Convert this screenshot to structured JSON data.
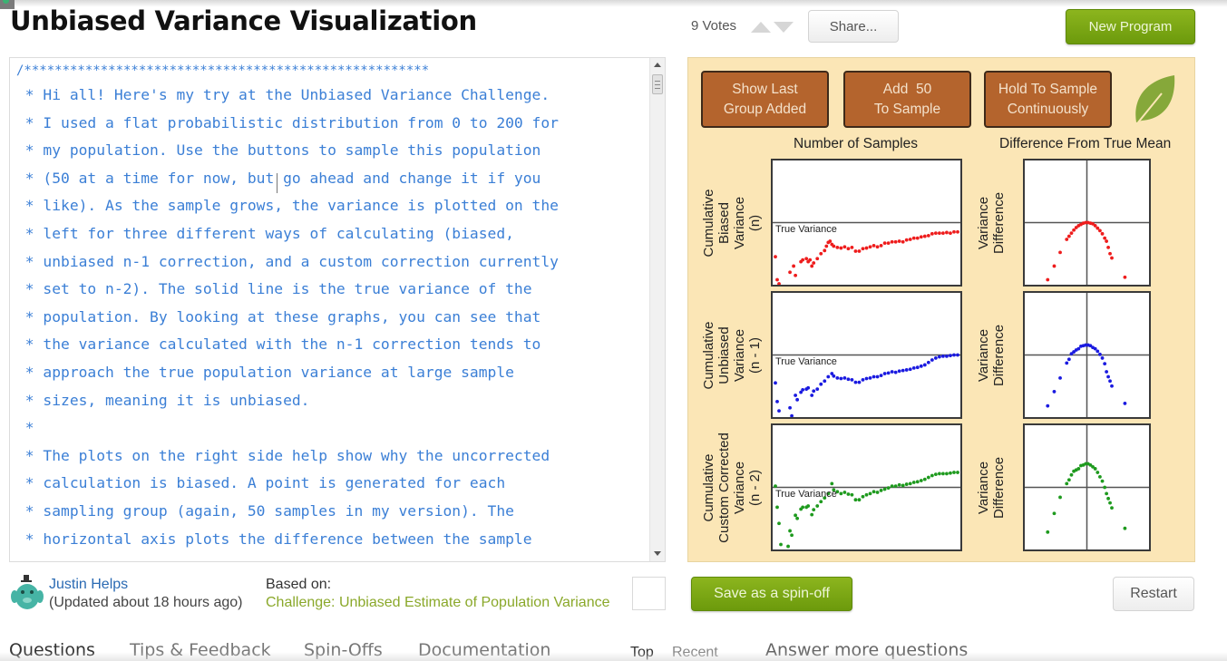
{
  "header": {
    "title": "Unbiased Variance Visualization",
    "votes_label": "9 Votes",
    "share_label": "Share...",
    "new_program_label": "New Program"
  },
  "editor": {
    "lines": [
      "/*****************************************************",
      " * Hi all! Here's my try at the Unbiased Variance Challenge.",
      " * I used a flat probabilistic distribution from 0 to 200 for",
      " * my population. Use the buttons to sample this population",
      " * (50 at a time for now, but go ahead and change it if you",
      " * like). As the sample grows, the variance is plotted on the",
      " * left for three different ways of calculating (biased,",
      " * unbiased n-1 correction, and a custom correction currently",
      " * set to n-2). The solid line is the true variance of the",
      " * population. By looking at these graphs, you can see that",
      " * the variance calculated with the n-1 correction tends to",
      " * approach the true population variance at large sample",
      " * sizes, meaning it is unbiased.",
      " *",
      " * The plots on the right side help show why the uncorrected",
      " * calculation is biased. A point is generated for each",
      " * sampling group (again, 50 samples in my version). The",
      " * horizontal axis plots the difference between the sample"
    ]
  },
  "panel": {
    "buttons": [
      {
        "line1": "Show Last",
        "line2": "Group Added"
      },
      {
        "line1": "Add  50",
        "line2": "To Sample"
      },
      {
        "line1": "Hold To Sample",
        "line2": "Continuously"
      }
    ],
    "colors": {
      "background": "#fbe6b6",
      "button": "#b4642d",
      "biased": "#ee1c1c",
      "unbiased": "#1a1ae0",
      "custom": "#1e9a1e",
      "leaf": "#86a83a"
    }
  },
  "chart_data": [
    {
      "type": "scatter",
      "title": "Number of Samples",
      "ylabel": [
        "Cumulative",
        "Biased",
        "Variance",
        "(n)"
      ],
      "annotation": "True Variance",
      "true_value": 0,
      "xlim": [
        0,
        100
      ],
      "ylim": [
        -1,
        1
      ],
      "color": "biased",
      "points": [
        [
          0,
          -0.55
        ],
        [
          1,
          -0.92
        ],
        [
          2,
          -1.0
        ],
        [
          8,
          -0.8
        ],
        [
          10,
          -0.7
        ],
        [
          11,
          -0.85
        ],
        [
          14,
          -0.63
        ],
        [
          15,
          -0.6
        ],
        [
          17,
          -0.58
        ],
        [
          18,
          -0.63
        ],
        [
          19,
          -0.6
        ],
        [
          20,
          -0.7
        ],
        [
          21,
          -0.65
        ],
        [
          23,
          -0.58
        ],
        [
          25,
          -0.5
        ],
        [
          27,
          -0.45
        ],
        [
          28,
          -0.38
        ],
        [
          29,
          -0.32
        ],
        [
          30,
          -0.3
        ],
        [
          31,
          -0.35
        ],
        [
          32,
          -0.38
        ],
        [
          34,
          -0.4
        ],
        [
          36,
          -0.41
        ],
        [
          38,
          -0.39
        ],
        [
          40,
          -0.42
        ],
        [
          42,
          -0.4
        ],
        [
          44,
          -0.46
        ],
        [
          46,
          -0.46
        ],
        [
          48,
          -0.42
        ],
        [
          50,
          -0.41
        ],
        [
          52,
          -0.39
        ],
        [
          54,
          -0.37
        ],
        [
          56,
          -0.39
        ],
        [
          58,
          -0.37
        ],
        [
          60,
          -0.33
        ],
        [
          62,
          -0.33
        ],
        [
          64,
          -0.31
        ],
        [
          66,
          -0.31
        ],
        [
          68,
          -0.3
        ],
        [
          70,
          -0.31
        ],
        [
          72,
          -0.28
        ],
        [
          74,
          -0.27
        ],
        [
          76,
          -0.25
        ],
        [
          78,
          -0.25
        ],
        [
          80,
          -0.23
        ],
        [
          82,
          -0.22
        ],
        [
          84,
          -0.21
        ],
        [
          86,
          -0.18
        ],
        [
          88,
          -0.17
        ],
        [
          90,
          -0.17
        ],
        [
          92,
          -0.17
        ],
        [
          94,
          -0.16
        ],
        [
          96,
          -0.17
        ],
        [
          98,
          -0.15
        ],
        [
          100,
          -0.15
        ]
      ]
    },
    {
      "type": "scatter",
      "title": "Difference From True Mean",
      "ylabel": [
        "Variance",
        "Difference"
      ],
      "xlim": [
        -1,
        1
      ],
      "ylim": [
        -1,
        1
      ],
      "color": "biased",
      "points": [
        [
          -0.66,
          -0.92
        ],
        [
          -0.55,
          -0.7
        ],
        [
          -0.45,
          -0.48
        ],
        [
          -0.34,
          -0.27
        ],
        [
          -0.3,
          -0.22
        ],
        [
          -0.26,
          -0.17
        ],
        [
          -0.22,
          -0.12
        ],
        [
          -0.18,
          -0.08
        ],
        [
          -0.14,
          -0.05
        ],
        [
          -0.1,
          -0.03
        ],
        [
          -0.06,
          -0.01
        ],
        [
          -0.02,
          0.0
        ],
        [
          0.02,
          0.0
        ],
        [
          0.06,
          -0.01
        ],
        [
          0.1,
          -0.02
        ],
        [
          0.14,
          -0.05
        ],
        [
          0.18,
          -0.09
        ],
        [
          0.22,
          -0.13
        ],
        [
          0.26,
          -0.18
        ],
        [
          0.3,
          -0.25
        ],
        [
          0.33,
          -0.3
        ],
        [
          0.36,
          -0.4
        ],
        [
          0.39,
          -0.5
        ],
        [
          0.42,
          -0.57
        ],
        [
          0.64,
          -0.88
        ]
      ]
    },
    {
      "type": "scatter",
      "title": "Number of Samples",
      "ylabel": [
        "Cumulative",
        "Unbiased",
        "Variance",
        "(n - 1)"
      ],
      "annotation": "True Variance",
      "true_value": 0,
      "xlim": [
        0,
        100
      ],
      "ylim": [
        -1,
        1
      ],
      "color": "unbiased",
      "points": [
        [
          0,
          -0.45
        ],
        [
          1,
          -0.75
        ],
        [
          2,
          -0.9
        ],
        [
          8,
          -0.85
        ],
        [
          9,
          -0.98
        ],
        [
          11,
          -0.65
        ],
        [
          12,
          -0.72
        ],
        [
          14,
          -0.6
        ],
        [
          15,
          -0.56
        ],
        [
          17,
          -0.55
        ],
        [
          18,
          -0.53
        ],
        [
          20,
          -0.65
        ],
        [
          21,
          -0.58
        ],
        [
          23,
          -0.55
        ],
        [
          25,
          -0.47
        ],
        [
          27,
          -0.42
        ],
        [
          29,
          -0.35
        ],
        [
          31,
          -0.3
        ],
        [
          32,
          -0.34
        ],
        [
          34,
          -0.37
        ],
        [
          36,
          -0.38
        ],
        [
          38,
          -0.37
        ],
        [
          40,
          -0.39
        ],
        [
          42,
          -0.4
        ],
        [
          44,
          -0.44
        ],
        [
          46,
          -0.44
        ],
        [
          48,
          -0.4
        ],
        [
          50,
          -0.38
        ],
        [
          52,
          -0.37
        ],
        [
          54,
          -0.35
        ],
        [
          56,
          -0.35
        ],
        [
          58,
          -0.33
        ],
        [
          60,
          -0.3
        ],
        [
          62,
          -0.29
        ],
        [
          64,
          -0.27
        ],
        [
          66,
          -0.28
        ],
        [
          68,
          -0.26
        ],
        [
          70,
          -0.25
        ],
        [
          72,
          -0.24
        ],
        [
          74,
          -0.23
        ],
        [
          76,
          -0.21
        ],
        [
          78,
          -0.2
        ],
        [
          80,
          -0.18
        ],
        [
          82,
          -0.16
        ],
        [
          84,
          -0.12
        ],
        [
          86,
          -0.08
        ],
        [
          88,
          -0.05
        ],
        [
          90,
          -0.03
        ],
        [
          92,
          -0.02
        ],
        [
          94,
          -0.02
        ],
        [
          96,
          -0.01
        ],
        [
          98,
          0.0
        ],
        [
          100,
          0.0
        ]
      ]
    },
    {
      "type": "scatter",
      "title": "Difference From True Mean",
      "ylabel": [
        "Variance",
        "Difference"
      ],
      "xlim": [
        -1,
        1
      ],
      "ylim": [
        -1,
        1
      ],
      "color": "unbiased",
      "points": [
        [
          -0.66,
          -0.82
        ],
        [
          -0.55,
          -0.59
        ],
        [
          -0.45,
          -0.37
        ],
        [
          -0.34,
          -0.13
        ],
        [
          -0.3,
          -0.07
        ],
        [
          -0.26,
          0.02
        ],
        [
          -0.22,
          0.05
        ],
        [
          -0.18,
          0.08
        ],
        [
          -0.14,
          0.1
        ],
        [
          -0.1,
          0.14
        ],
        [
          -0.06,
          0.15
        ],
        [
          -0.02,
          0.16
        ],
        [
          0.02,
          0.16
        ],
        [
          0.06,
          0.15
        ],
        [
          0.1,
          0.12
        ],
        [
          0.14,
          0.1
        ],
        [
          0.18,
          0.06
        ],
        [
          0.22,
          0.01
        ],
        [
          0.26,
          -0.05
        ],
        [
          0.3,
          -0.14
        ],
        [
          0.33,
          -0.27
        ],
        [
          0.36,
          -0.35
        ],
        [
          0.39,
          -0.42
        ],
        [
          0.42,
          -0.5
        ],
        [
          0.64,
          -0.78
        ]
      ]
    },
    {
      "type": "scatter",
      "title": "Number of Samples",
      "ylabel": [
        "Cumulative",
        "Custom Corrected",
        "Variance",
        "(n - 2)"
      ],
      "annotation": "True Variance",
      "true_value": 0,
      "xlim": [
        0,
        100
      ],
      "ylim": [
        -1,
        1
      ],
      "color": "custom",
      "points": [
        [
          0,
          0.02
        ],
        [
          1,
          -0.32
        ],
        [
          2,
          -0.58
        ],
        [
          3,
          -0.92
        ],
        [
          7,
          -0.95
        ],
        [
          8,
          -0.7
        ],
        [
          9,
          -0.77
        ],
        [
          11,
          -0.45
        ],
        [
          12,
          -0.5
        ],
        [
          14,
          -0.35
        ],
        [
          15,
          -0.32
        ],
        [
          17,
          -0.32
        ],
        [
          18,
          -0.3
        ],
        [
          20,
          -0.44
        ],
        [
          21,
          -0.36
        ],
        [
          23,
          -0.3
        ],
        [
          25,
          -0.23
        ],
        [
          27,
          -0.17
        ],
        [
          29,
          -0.1
        ],
        [
          31,
          0.06
        ],
        [
          32,
          -0.04
        ],
        [
          34,
          -0.07
        ],
        [
          36,
          -0.1
        ],
        [
          38,
          -0.08
        ],
        [
          40,
          -0.11
        ],
        [
          42,
          -0.12
        ],
        [
          44,
          -0.2
        ],
        [
          46,
          -0.2
        ],
        [
          48,
          -0.15
        ],
        [
          50,
          -0.12
        ],
        [
          52,
          -0.1
        ],
        [
          54,
          -0.07
        ],
        [
          56,
          -0.08
        ],
        [
          58,
          -0.05
        ],
        [
          60,
          -0.03
        ],
        [
          62,
          -0.01
        ],
        [
          64,
          0.02
        ],
        [
          66,
          0.02
        ],
        [
          68,
          0.04
        ],
        [
          70,
          0.03
        ],
        [
          72,
          0.05
        ],
        [
          74,
          0.06
        ],
        [
          76,
          0.08
        ],
        [
          78,
          0.09
        ],
        [
          80,
          0.11
        ],
        [
          82,
          0.13
        ],
        [
          84,
          0.16
        ],
        [
          86,
          0.19
        ],
        [
          88,
          0.21
        ],
        [
          90,
          0.22
        ],
        [
          92,
          0.22
        ],
        [
          94,
          0.22
        ],
        [
          96,
          0.23
        ],
        [
          98,
          0.24
        ],
        [
          100,
          0.24
        ]
      ]
    },
    {
      "type": "scatter",
      "title": "Difference From True Mean",
      "ylabel": [
        "Variance",
        "Difference"
      ],
      "xlim": [
        -1,
        1
      ],
      "ylim": [
        -1,
        1
      ],
      "color": "custom",
      "points": [
        [
          -0.66,
          -0.72
        ],
        [
          -0.55,
          -0.42
        ],
        [
          -0.45,
          -0.16
        ],
        [
          -0.34,
          0.06
        ],
        [
          -0.3,
          0.12
        ],
        [
          -0.26,
          0.2
        ],
        [
          -0.22,
          0.26
        ],
        [
          -0.18,
          0.28
        ],
        [
          -0.14,
          0.3
        ],
        [
          -0.1,
          0.35
        ],
        [
          -0.06,
          0.36
        ],
        [
          -0.02,
          0.38
        ],
        [
          0.02,
          0.38
        ],
        [
          0.06,
          0.36
        ],
        [
          0.1,
          0.33
        ],
        [
          0.14,
          0.3
        ],
        [
          0.18,
          0.24
        ],
        [
          0.22,
          0.17
        ],
        [
          0.26,
          0.1
        ],
        [
          0.3,
          -0.0
        ],
        [
          0.33,
          -0.1
        ],
        [
          0.36,
          -0.18
        ],
        [
          0.39,
          -0.25
        ],
        [
          0.42,
          -0.33
        ],
        [
          0.64,
          -0.66
        ]
      ]
    }
  ],
  "footer": {
    "author_name": "Justin Helps",
    "author_updated": "(Updated about 18 hours ago)",
    "based_on_label": "Based on:",
    "based_on_link": "Challenge: Unbiased Estimate of Population Variance",
    "save_spinoff_label": "Save as a spin-off",
    "restart_label": "Restart",
    "tabs": [
      "Questions",
      "Tips & Feedback",
      "Spin-Offs",
      "Documentation"
    ],
    "sort_top": "Top",
    "sort_recent": "Recent",
    "answer_more": "Answer more questions"
  }
}
